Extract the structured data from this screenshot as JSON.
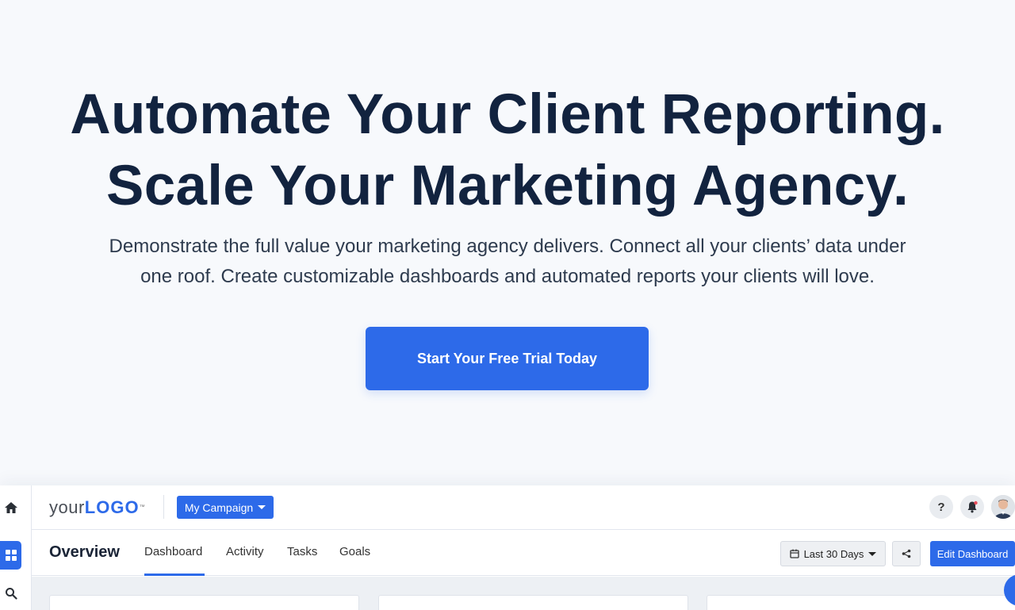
{
  "hero": {
    "title_line1": "Automate Your Client Reporting.",
    "title_line2": "Scale Your Marketing Agency.",
    "subtitle_line1": "Demonstrate the full value your marketing agency delivers. Connect all your clients’ data under",
    "subtitle_line2": "one roof. Create customizable dashboards and automated reports your clients will love.",
    "cta_label": "Start Your Free Trial Today"
  },
  "app": {
    "logo": {
      "prefix": "your",
      "brand": "LOGO",
      "tm": "™"
    },
    "campaign_label": "My Campaign",
    "help_label": "?",
    "page_title": "Overview",
    "tabs": [
      {
        "label": "Dashboard",
        "active": true
      },
      {
        "label": "Activity",
        "active": false
      },
      {
        "label": "Tasks",
        "active": false
      },
      {
        "label": "Goals",
        "active": false
      }
    ],
    "date_range_label": "Last 30 Days",
    "edit_label": "Edit Dashboard",
    "sidebar_icons": [
      "home-icon",
      "grid-icon",
      "search-icon"
    ]
  },
  "colors": {
    "accent": "#2d6ae9",
    "heading": "#12233f",
    "background": "#f7f9fc"
  }
}
